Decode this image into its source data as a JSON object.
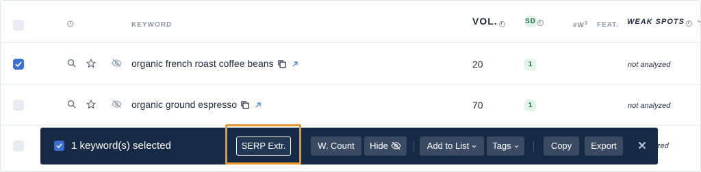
{
  "header": {
    "keyword": "KEYWORD",
    "vol": "VOL.",
    "sd": "SD",
    "w3_base": "#W",
    "w3_sup": "3",
    "feat": "FEAT.",
    "weak_spots": "WEAK SPOTS"
  },
  "rows": [
    {
      "keyword": "organic french roast coffee beans",
      "volume": "20",
      "sd": "1",
      "weak_spots": "not analyzed",
      "checked": true
    },
    {
      "keyword": "organic ground espresso",
      "volume": "70",
      "sd": "1",
      "weak_spots": "not analyzed",
      "checked": false
    },
    {
      "weak_spots_partial": "zed",
      "checked": false
    }
  ],
  "action_bar": {
    "selected_text": "1 keyword(s) selected",
    "serp_label": "SERP Extr.",
    "wcount_label": "W. Count",
    "hide_label": "Hide",
    "addlist_label": "Add to List",
    "tags_label": "Tags",
    "copy_label": "Copy",
    "export_label": "Export"
  },
  "colors": {
    "bar_bg": "#172a45",
    "checkbox_checked": "#3b6fd4",
    "highlight": "#e9972d",
    "sd_badge_bg": "#e3f3e9"
  }
}
